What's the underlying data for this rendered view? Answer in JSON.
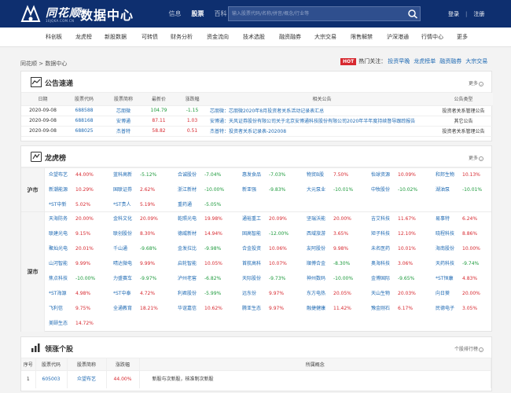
{
  "brand": {
    "name": "同花顺",
    "url": "10JQKA.COM.CN",
    "site_title": "数据中心"
  },
  "top_nav": [
    {
      "label": "信息",
      "active": false
    },
    {
      "label": "股票",
      "active": true
    },
    {
      "label": "百科",
      "active": false
    }
  ],
  "search": {
    "placeholder": "输入股票代码/名称/拼音/概念/行业等"
  },
  "auth": {
    "login": "登录",
    "register": "注册"
  },
  "sub_nav": [
    "科创板",
    "龙虎榜",
    "新股数据",
    "可转债",
    "财务分析",
    "资金流向",
    "技术选股",
    "融资融券",
    "大宗交易",
    "限售解禁",
    "沪深港通",
    "行情中心",
    "更多"
  ],
  "breadcrumb": "同花顺 > 数据中心",
  "hot": {
    "tag": "HOT",
    "label": "热门关注：",
    "links": [
      "投资早晚",
      "龙虎榜单",
      "融资融券",
      "大宗交易"
    ]
  },
  "announcements": {
    "title": "公告速递",
    "more": "更多",
    "columns": [
      "日期",
      "股票代码",
      "股票简称",
      "最新价",
      "涨跌幅",
      "相关公告",
      "公告类型"
    ],
    "rows": [
      {
        "date": "2020-09-08",
        "code": "688588",
        "name": "芯朋微",
        "price": "104.79",
        "change": "-1.15",
        "title": "芯朋微：芯朋微2020年8月投资者关系活动记录表汇总",
        "type": "投资者关系管理公告"
      },
      {
        "date": "2020-09-08",
        "code": "688168",
        "name": "安博通",
        "price": "87.11",
        "change": "1.03",
        "title": "安博通：天风证券股份有限公司关于北京安博通科技股份有限公司2020年半年度持续督导跟踪报告",
        "type": "其它公告"
      },
      {
        "date": "2020-09-08",
        "code": "688025",
        "name": "杰普特",
        "price": "58.82",
        "change": "0.51",
        "title": "杰普特：投资者关系记录表-202008",
        "type": "投资者关系管理公告"
      }
    ]
  },
  "lhb": {
    "title": "龙虎榜",
    "more": "更多",
    "markets": [
      {
        "label": "沪市",
        "rows": [
          [
            {
              "n": "众望布艺",
              "p": "44.00%"
            },
            {
              "n": "蓝科高新",
              "p": "-5.12%"
            },
            {
              "n": "合诚股份",
              "p": "-7.04%"
            },
            {
              "n": "惠发食品",
              "p": "-7.03%"
            },
            {
              "n": "物贸B股",
              "p": "7.50%"
            },
            {
              "n": "怡球资源",
              "p": "10.09%"
            },
            {
              "n": "和邦生物",
              "p": "10.13%"
            }
          ],
          [
            {
              "n": "新潮能源",
              "p": "10.29%"
            },
            {
              "n": "国联证券",
              "p": "2.62%"
            },
            {
              "n": "浙江新材",
              "p": "-10.00%"
            },
            {
              "n": "新亚强",
              "p": "-9.83%"
            },
            {
              "n": "大元泵业",
              "p": "-10.01%"
            },
            {
              "n": "中牧股份",
              "p": "-10.02%"
            },
            {
              "n": "湖油泵",
              "p": "-10.01%"
            }
          ],
          [
            {
              "n": "*ST中新",
              "p": "5.02%"
            },
            {
              "n": "*ST贵人",
              "p": "5.19%"
            },
            {
              "n": "重药通",
              "p": "-5.05%"
            }
          ]
        ]
      },
      {
        "label": "深市",
        "rows": [
          [
            {
              "n": "天海防务",
              "p": "20.00%"
            },
            {
              "n": "金科文化",
              "p": "20.09%"
            },
            {
              "n": "乾照光电",
              "p": "19.98%"
            },
            {
              "n": "通裕重工",
              "p": "20.09%"
            },
            {
              "n": "坚瑞沃能",
              "p": "20.00%"
            },
            {
              "n": "吉艾科技",
              "p": "11.67%"
            },
            {
              "n": "易事特",
              "p": "6.24%"
            }
          ],
          [
            {
              "n": "联建光电",
              "p": "9.15%"
            },
            {
              "n": "联创股份",
              "p": "8.30%"
            },
            {
              "n": "德威新材",
              "p": "14.94%"
            },
            {
              "n": "固高智能",
              "p": "-12.00%"
            },
            {
              "n": "西域旅游",
              "p": "3.65%"
            },
            {
              "n": "矩子科技",
              "p": "12.10%"
            },
            {
              "n": "晓程科技",
              "p": "8.86%"
            }
          ],
          [
            {
              "n": "聚灿光电",
              "p": "20.01%"
            },
            {
              "n": "千山通",
              "p": "-9.68%"
            },
            {
              "n": "金发拉比",
              "p": "-9.98%"
            },
            {
              "n": "合金投资",
              "p": "10.06%"
            },
            {
              "n": "友阿股份",
              "p": "9.98%"
            },
            {
              "n": "未名医药",
              "p": "10.01%"
            },
            {
              "n": "海南股份",
              "p": "10.00%"
            }
          ],
          [
            {
              "n": "山河智能",
              "p": "9.99%"
            },
            {
              "n": "晴达微电",
              "p": "9.99%"
            },
            {
              "n": "启轮智能",
              "p": "10.05%"
            },
            {
              "n": "首航高科",
              "p": "10.07%"
            },
            {
              "n": "順博合金",
              "p": "-8.30%"
            },
            {
              "n": "奥海科技",
              "p": "3.06%"
            },
            {
              "n": "天药科技",
              "p": "-9.74%"
            }
          ],
          [
            {
              "n": "焦点科技",
              "p": "-10.00%"
            },
            {
              "n": "力盛赛车",
              "p": "-9.97%"
            },
            {
              "n": "泸州老窖",
              "p": "-6.82%"
            },
            {
              "n": "天际股份",
              "p": "-9.73%"
            },
            {
              "n": "神州数码",
              "p": "-10.00%"
            },
            {
              "n": "金博国际",
              "p": "-9.65%"
            },
            {
              "n": "*ST恒康",
              "p": "4.83%"
            }
          ],
          [
            {
              "n": "*ST海源",
              "p": "4.98%"
            },
            {
              "n": "*ST中泰",
              "p": "4.72%"
            },
            {
              "n": "利君股份",
              "p": "-5.99%"
            },
            {
              "n": "远东份",
              "p": "9.97%"
            },
            {
              "n": "东方电热",
              "p": "20.05%"
            },
            {
              "n": "天山生物",
              "p": "20.03%"
            },
            {
              "n": "向日葵",
              "p": "20.00%"
            }
          ],
          [
            {
              "n": "飞利信",
              "p": "9.75%"
            },
            {
              "n": "全通教育",
              "p": "18.21%"
            },
            {
              "n": "华谊嘉信",
              "p": "10.62%"
            },
            {
              "n": "腾亚生态",
              "p": "9.97%"
            },
            {
              "n": "融捷健康",
              "p": "11.42%"
            },
            {
              "n": "豫金刚石",
              "p": "6.17%"
            },
            {
              "n": "民德电子",
              "p": "3.05%"
            }
          ],
          [
            {
              "n": "美颐生态",
              "p": "14.72%"
            }
          ]
        ]
      }
    ]
  },
  "leaders": {
    "title": "领涨个股",
    "more": "个股排行榜",
    "columns": [
      "序号",
      "股票代码",
      "股票简称",
      "涨跌幅",
      "所属概念"
    ],
    "rows": [
      {
        "idx": "1",
        "code": "605003",
        "name": "众望布艺",
        "change": "44.00%",
        "concept": "新股与次新股，核准制次新股"
      }
    ]
  }
}
